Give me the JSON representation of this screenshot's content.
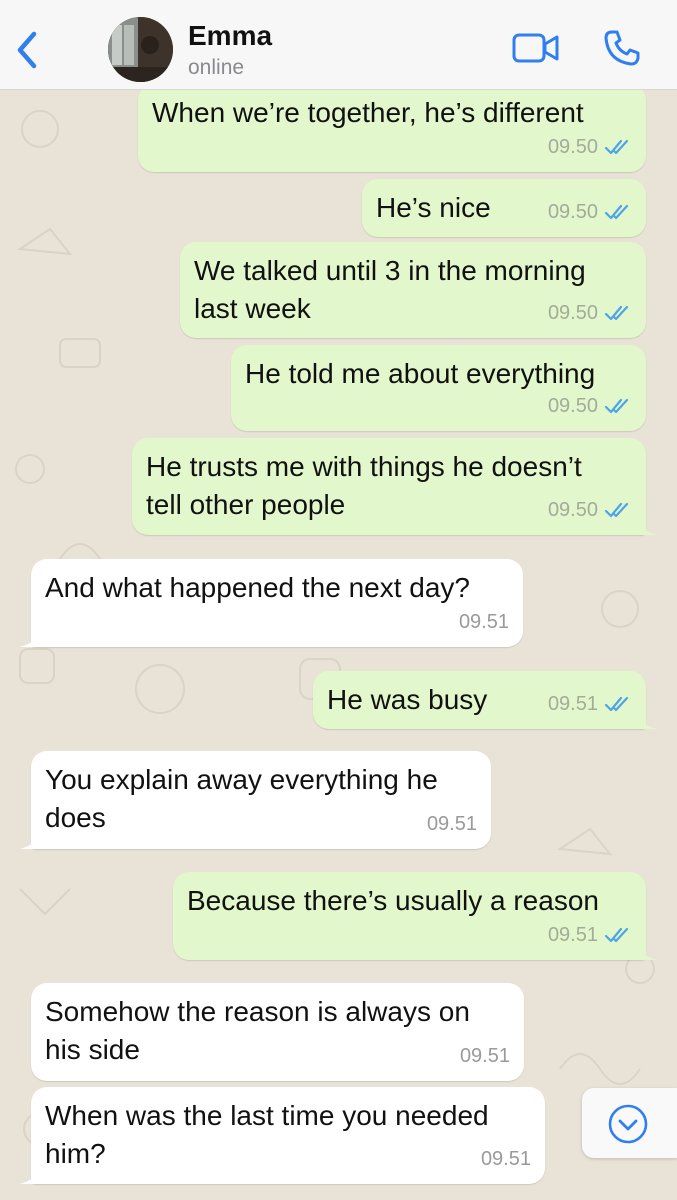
{
  "header": {
    "contact_name": "Emma",
    "status": "online"
  },
  "colors": {
    "accent": "#2f7ff0",
    "outgoing_bubble": "#e2f7cb",
    "incoming_bubble": "#ffffff",
    "read_ticks": "#4fa3e8"
  },
  "messages": [
    {
      "direction": "out",
      "text": "When we’re together, he’s different",
      "time": "09.50",
      "read": true
    },
    {
      "direction": "out",
      "text": "He’s nice",
      "time": "09.50",
      "read": true
    },
    {
      "direction": "out",
      "line1": "We talked until 3 in the morning",
      "line2": "last week",
      "time": "09.50",
      "read": true
    },
    {
      "direction": "out",
      "text": "He told me about everything",
      "time": "09.50",
      "read": true
    },
    {
      "direction": "out",
      "line1": "He trusts me with things he doesn’t",
      "line2": "tell other people",
      "time": "09.50",
      "read": true
    },
    {
      "direction": "in",
      "text": "And what happened the next day?",
      "time": "09.51"
    },
    {
      "direction": "out",
      "text": "He was busy",
      "time": "09.51",
      "read": true
    },
    {
      "direction": "in",
      "line1": "You explain away everything he",
      "line2": "does",
      "time": "09.51"
    },
    {
      "direction": "out",
      "text": "Because there’s usually a reason",
      "time": "09.51",
      "read": true
    },
    {
      "direction": "in",
      "line1": "Somehow the reason is always on",
      "line2": "his side",
      "time": "09.51"
    },
    {
      "direction": "in",
      "line1": "When was the last time you needed",
      "line2": "him?",
      "time": "09.51"
    }
  ]
}
